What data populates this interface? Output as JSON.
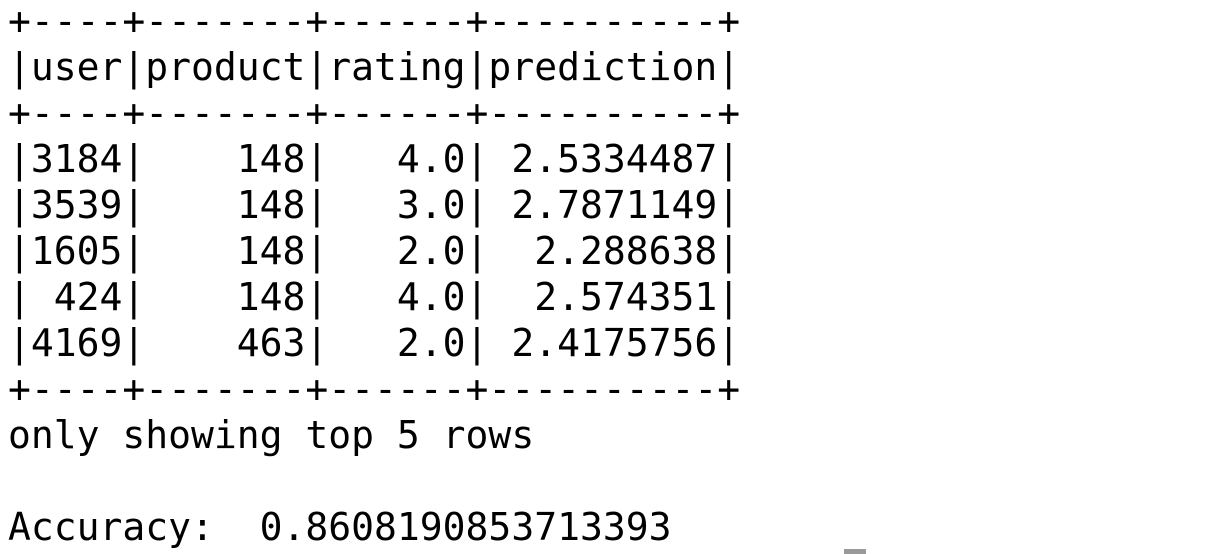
{
  "terminal": {
    "lines": [
      "+----+-------+------+----------+",
      "|user|product|rating|prediction|",
      "+----+-------+------+----------+",
      "|3184|    148|   4.0| 2.5334487|",
      "|3539|    148|   3.0| 2.7871149|",
      "|1605|    148|   2.0|  2.288638|",
      "| 424|    148|   4.0|  2.574351|",
      "|4169|    463|   2.0| 2.4175756|",
      "+----+-------+------+----------+",
      "only showing top 5 rows",
      "",
      "Accuracy:  0.8608190853713393"
    ]
  },
  "table": {
    "columns": [
      "user",
      "product",
      "rating",
      "prediction"
    ],
    "rows": [
      [
        "3184",
        "148",
        "4.0",
        "2.5334487"
      ],
      [
        "3539",
        "148",
        "3.0",
        "2.7871149"
      ],
      [
        "1605",
        "148",
        "2.0",
        "2.288638"
      ],
      [
        "424",
        "148",
        "4.0",
        "2.574351"
      ],
      [
        "4169",
        "463",
        "2.0",
        "2.4175756"
      ]
    ],
    "footer": "only showing top 5 rows"
  },
  "accuracy": {
    "label": "Accuracy:",
    "value": "0.8608190853713393"
  }
}
